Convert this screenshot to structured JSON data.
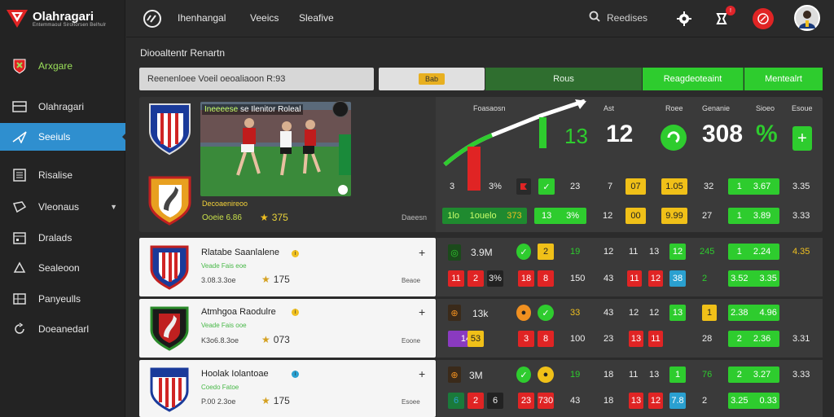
{
  "app": {
    "logo_title": "Olahragari",
    "logo_sub": "Entemmaoul Siroltorsen Belhulr"
  },
  "topbar": {
    "nav": [
      "Ihenhangal",
      "Veeics",
      "Sleafive"
    ],
    "search_label": "Reedises"
  },
  "sidebar": {
    "items": [
      {
        "label": "Arxgare",
        "icon": "shield-icon"
      },
      {
        "label": "Olahragari",
        "icon": "scoreboard-icon"
      },
      {
        "label": "Seeiuls",
        "icon": "paper-plane-icon"
      },
      {
        "label": "Risalise",
        "icon": "list-icon"
      },
      {
        "label": "Vleonaus",
        "icon": "tag-icon"
      },
      {
        "label": "Dralads",
        "icon": "calendar-icon"
      },
      {
        "label": "Sealeoon",
        "icon": "video-icon"
      },
      {
        "label": "Panyeulls",
        "icon": "table-icon"
      },
      {
        "label": "Doeanedarl",
        "icon": "refresh-icon"
      }
    ]
  },
  "content": {
    "section_title": "Diooaltentr Renartn",
    "filter_input": "Reenenloee Voeil oeoaliaoon R:93",
    "filter_pill": "Bab",
    "filter_dark": "Rous",
    "filter_green1": "Reagdeoteaint",
    "filter_green2": "Mentealrt"
  },
  "featured": {
    "title_pre": "Ineeeese",
    "title": "se Ilenitor Roleal",
    "subtitle": "Decoaenireoo",
    "odds": "Ooeie 6.86",
    "score": "375",
    "side_value": "Daeesn",
    "headers": [
      "Foasaosn",
      "Ast",
      "Roee",
      "Genanie",
      "Sioeo",
      "Esoue"
    ],
    "big_values": [
      "13",
      "12",
      "308",
      "%"
    ],
    "row1": [
      "3",
      "3%",
      "23",
      "7",
      "07",
      "1.05",
      "32",
      "1",
      "3.67",
      "3.35"
    ],
    "row2": [
      "1lo",
      "1ouelo",
      "373",
      "13",
      "3%",
      "12",
      "00",
      "9.99",
      "27",
      "1",
      "3.89",
      "3.33"
    ]
  },
  "matches": [
    {
      "name": "Rlatabe Saanlalene",
      "sub": "Veade Fais eoe",
      "odds": "3.08.3.3oe",
      "score": "175",
      "note": "Beaoe",
      "top": [
        "3.9M",
        "2",
        "19",
        "12",
        "11",
        "13",
        "12",
        "245",
        "1",
        "2.24",
        "4.35"
      ],
      "bot": [
        "11",
        "2",
        "3%",
        "18",
        "8",
        "150",
        "43",
        "11",
        "12",
        "38",
        "2",
        "3.52",
        "3.35"
      ]
    },
    {
      "name": "Atmhgoa Raodulre",
      "sub": "Veade Fais ooe",
      "odds": "K3o6.8.3oe",
      "score": "073",
      "note": "Eoone",
      "top": [
        "13k",
        "33",
        "43",
        "12",
        "12",
        "13",
        "1",
        "2.38",
        "4.96"
      ],
      "bot": [
        "14",
        "53",
        "3",
        "8",
        "100",
        "23",
        "13",
        "11",
        "28",
        "2",
        "2.36",
        "3.31"
      ]
    },
    {
      "name": "Hoolak Iolantoae",
      "sub": "Coedo Fatoe",
      "odds": "P.00 2.3oe",
      "score": "175",
      "note": "Esoee",
      "top": [
        "3M",
        "19",
        "18",
        "11",
        "13",
        "1",
        "76",
        "2",
        "3.27",
        "3.33"
      ],
      "bot": [
        "6",
        "2",
        "6",
        "23",
        "730",
        "43",
        "18",
        "13",
        "12",
        "7.8",
        "2",
        "3.25",
        "0.33"
      ]
    }
  ]
}
